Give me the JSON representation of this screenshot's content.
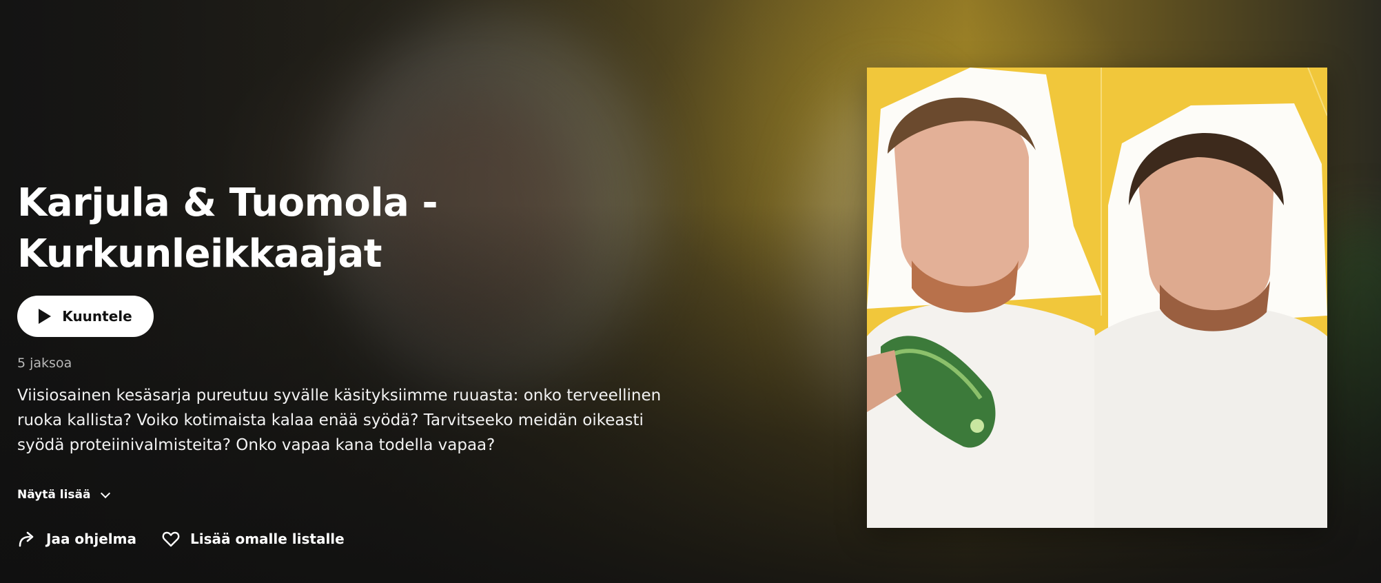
{
  "program": {
    "title": "Karjula & Tuomola - Kurkunleikkaajat",
    "play_label": "Kuuntele",
    "episode_count": "5 jaksoa",
    "description": "Viisiosainen kesäsarja pureutuu syvälle käsityksiimme ruuasta: onko terveellinen ruoka kallista? Voiko kotimaista kalaa enää syödä? Tarvitseeko meidän oikeasti syödä proteiinivalmisteita? Onko vapaa kana todella vapaa?",
    "show_more_label": "Näytä lisää"
  },
  "actions": {
    "share_label": "Jaa ohjelma",
    "add_to_list_label": "Lisää omalle listalle"
  },
  "icons": {
    "play": "play-icon",
    "chevron": "chevron-down-icon",
    "share": "share-arrow-icon",
    "favorite": "heart-icon"
  },
  "colors": {
    "cover_background": "#f1c73b",
    "button_background": "#ffffff",
    "text_primary": "#ffffff",
    "text_secondary": "#b9b9b9"
  }
}
